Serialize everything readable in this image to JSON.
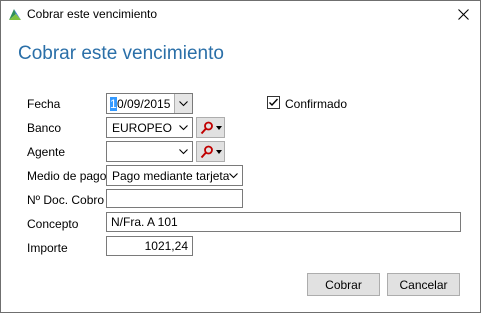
{
  "window": {
    "title": "Cobrar este vencimiento",
    "close_glyph": "✕"
  },
  "heading": "Cobrar este vencimiento",
  "form": {
    "fecha": {
      "label": "Fecha",
      "value_first": "1",
      "value_rest": "0/09/2015"
    },
    "confirmado": {
      "label": "Confirmado",
      "checked": true
    },
    "banco": {
      "label": "Banco",
      "value": "EUROPEO"
    },
    "agente": {
      "label": "Agente",
      "value": ""
    },
    "medio_pago": {
      "label": "Medio de pago",
      "value": "Pago mediante tarjeta"
    },
    "doc_cobro": {
      "label": "Nº Doc. Cobro",
      "value": ""
    },
    "concepto": {
      "label": "Concepto",
      "value": "N/Fra. A 101"
    },
    "importe": {
      "label": "Importe",
      "value": "1021,24"
    }
  },
  "buttons": {
    "cobrar": "Cobrar",
    "cancelar": "Cancelar"
  },
  "icons": {
    "app": "app-logo-icon",
    "search": "search-icon",
    "dropdown": "chevron-down-icon"
  }
}
